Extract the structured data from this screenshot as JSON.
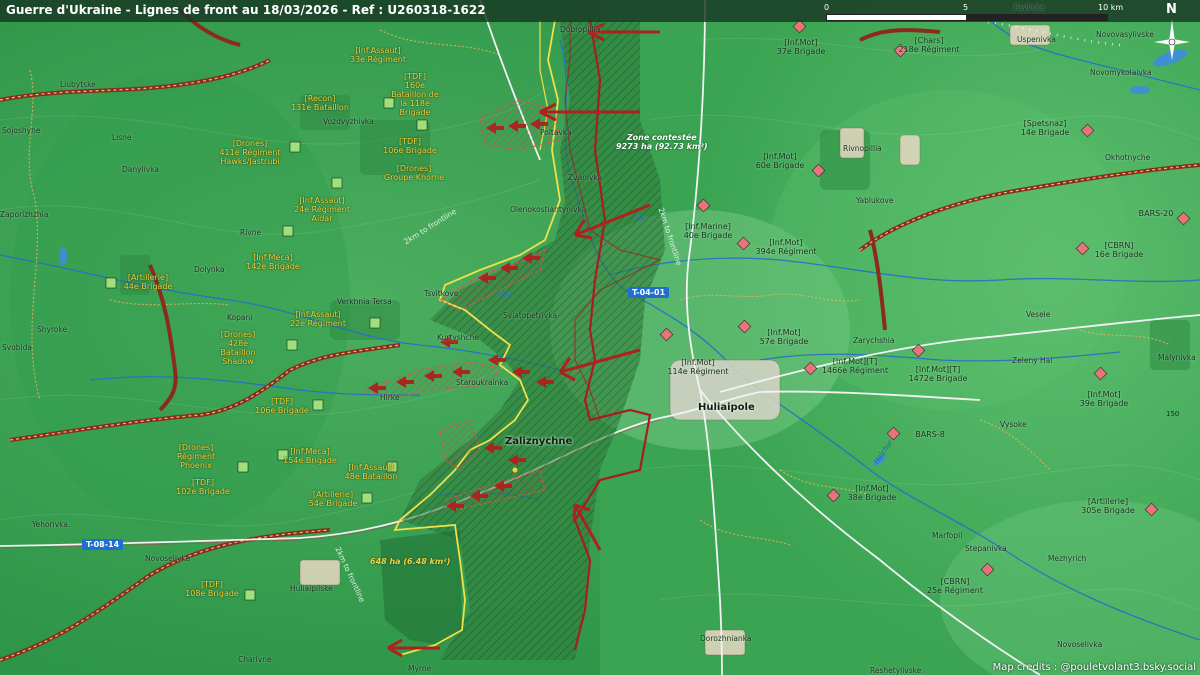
{
  "title": "Guerre d'Ukraine - Lignes de front au 18/03/2026 - Ref : U260318-1622",
  "scale": {
    "ticks": [
      "0",
      "5",
      "10 km"
    ]
  },
  "north_label": "N",
  "credits": "Map credits : @pouletvolant3.bsky.social",
  "colors": {
    "ua_front": "#f0e04a",
    "ru_front": "#a81d1d",
    "ru_arrow": "#b0201c",
    "road_badge": "#1e6fd0",
    "ua_label": "#f3d23a"
  },
  "zones": {
    "contested": {
      "title": "Zone contestée",
      "area": "9273 ha (92.73 km²)"
    },
    "pocket": {
      "area": "648 ha (6.48 km²)"
    }
  },
  "distance_labels": [
    "2km to frontline",
    "2km to frontline",
    "2km to frontline"
  ],
  "roads": [
    "T-04-01",
    "T-08-14"
  ],
  "rivers": [
    "Haichur"
  ],
  "side_value": "150",
  "places": {
    "huliaipole": "Huliaipole",
    "zaliznychne": "Zaliznychne",
    "dobropillia": "Dobropillia",
    "pavlivka": "Pavlivka",
    "uspenivka": "Uspenivka",
    "novovasylivske": "Novovasylivske",
    "novomykolaivka": "Novomykolaivka",
    "liubytske": "Liubytske",
    "sojoshyne": "Sojoshyne",
    "lisne": "Lisne",
    "danylivka": "Danylivka",
    "vozdvyzhivka": "Vozdvyzhivka",
    "poltavka": "Poltavka",
    "zaporizhzhia": "Zaporizhzhia",
    "zlahoda": "Zlahoda",
    "rivnopillia": "Rivnopillia",
    "okhotnyche": "Okhotnyche",
    "yablukove": "Yablukove",
    "olenokostiantynivka": "Olenokostiantynivka",
    "zvanivka": "Zvanivka",
    "rivne": "Rivne",
    "dolynka": "Dolynka",
    "tsvitkove": "Tsvitkove",
    "verkhnia_tersa": "Verkhnia Tersa",
    "kopani": "Kopani",
    "shyroke": "Shyroke",
    "svobida": "Svobida",
    "kurtyshche": "Kurtyshche",
    "sviatopetrivka": "Sviatopetrivka",
    "staroukrainka": "Staroukrainka",
    "hirke": "Hirke",
    "zarychshia": "Zarychshia",
    "vesele": "Vesele",
    "zeleny_hai": "Zeleny Hai",
    "malynivka": "Malynivka",
    "vysoke": "Vysoke",
    "marfopil": "Marfopil",
    "stepanivka": "Stepanivka",
    "mezhyrich": "Mezhyrich",
    "novoselivka": "Novoselivka",
    "novoselivka2": "Novoselivka",
    "dorozhnianka": "Dorozhnianka",
    "yehorivka": "Yehorivka",
    "huliaipilske": "Huliaipilske",
    "charivne": "Charivne",
    "myrne": "Myrne",
    "reshetylivske": "Reshetylivske"
  },
  "ua_units": [
    {
      "type": "[Inf.Assaut]",
      "name": "33e Régiment"
    },
    {
      "type": "[TDF]",
      "name": "160e Bataillon de la 118e Brigade"
    },
    {
      "type": "[Recon]",
      "name": "131e Bataillon"
    },
    {
      "type": "[TDF]",
      "name": "106e Brigade"
    },
    {
      "type": "[Drones]",
      "name": "411e Régiment Hawks/Jastrubi"
    },
    {
      "type": "[Drones]",
      "name": "Groupe Khorne"
    },
    {
      "type": "[Inf.Assaut]",
      "name": "24e Régiment Aidar"
    },
    {
      "type": "[Inf.Meca]",
      "name": "142e Brigade"
    },
    {
      "type": "[Artillerie]",
      "name": "44e Brigade"
    },
    {
      "type": "[Inf.Assaut]",
      "name": "22e Régiment"
    },
    {
      "type": "[Drones]",
      "name": "428e Bataillon Shadow"
    },
    {
      "type": "[TDF]",
      "name": "106e Brigade"
    },
    {
      "type": "[Drones]",
      "name": "Régiment Phoenix"
    },
    {
      "type": "[Inf.Meca]",
      "name": "154e Brigade"
    },
    {
      "type": "[Inf.Assaut]",
      "name": "48e Bataillon"
    },
    {
      "type": "[TDF]",
      "name": "102e Brigade"
    },
    {
      "type": "[Artillerie]",
      "name": "54e Brigade"
    },
    {
      "type": "[TDF]",
      "name": "108e Brigade"
    }
  ],
  "ru_units": [
    {
      "type": "[Inf.Mot]",
      "name": "37e Brigade"
    },
    {
      "type": "[Chars]",
      "name": "218e Régiment"
    },
    {
      "type": "[Spetsnaz]",
      "name": "14e Brigade"
    },
    {
      "type": "[Inf.Mot]",
      "name": "60e Brigade"
    },
    {
      "type": "",
      "name": "BARS-20"
    },
    {
      "type": "[Inf.Marine]",
      "name": "40e Brigade"
    },
    {
      "type": "[Inf.Mot]",
      "name": "394e Régiment"
    },
    {
      "type": "[CBRN]",
      "name": "16e Brigade"
    },
    {
      "type": "[Inf.Mot]",
      "name": "57e Brigade"
    },
    {
      "type": "[Inf.Mot]",
      "name": "114e Régiment"
    },
    {
      "type": "[Inf.Mot][T]",
      "name": "1466e Régiment"
    },
    {
      "type": "[Inf.Mot][T]",
      "name": "1472e Brigade"
    },
    {
      "type": "[Inf.Mot]",
      "name": "39e Brigade"
    },
    {
      "type": "",
      "name": "BARS-8"
    },
    {
      "type": "[Inf.Mot]",
      "name": "38e Brigade"
    },
    {
      "type": "[Artillerie]",
      "name": "305e Brigade"
    },
    {
      "type": "[CBRN]",
      "name": "25e Régiment"
    }
  ]
}
